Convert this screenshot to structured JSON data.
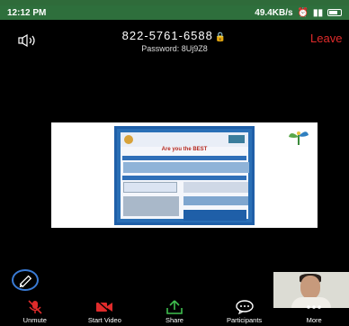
{
  "status_bar": {
    "time": "12:12 PM",
    "net_speed": "49.4KB/s",
    "signal_text": "ᵢₗ ᵢₗ"
  },
  "meeting": {
    "id": "822-5761-6588",
    "password": "Password: 8Uj9Z8",
    "leave_label": "Leave"
  },
  "poster": {
    "title": "Are you the BEST"
  },
  "toolbar": {
    "items": [
      {
        "label": "Unmute",
        "icon": "muted-mic-icon"
      },
      {
        "label": "Start Video",
        "icon": "video-off-icon"
      },
      {
        "label": "Share",
        "icon": "share-icon"
      },
      {
        "label": "Participants",
        "icon": "participants-icon"
      },
      {
        "label": "More",
        "icon": "more-icon"
      }
    ]
  },
  "colors": {
    "status_bar": "#2e6f3c",
    "leave": "#e02b2b",
    "danger_icon": "#e02b2b",
    "share_icon": "#3fbf4f",
    "pencil_ring": "#3a7bd5"
  }
}
